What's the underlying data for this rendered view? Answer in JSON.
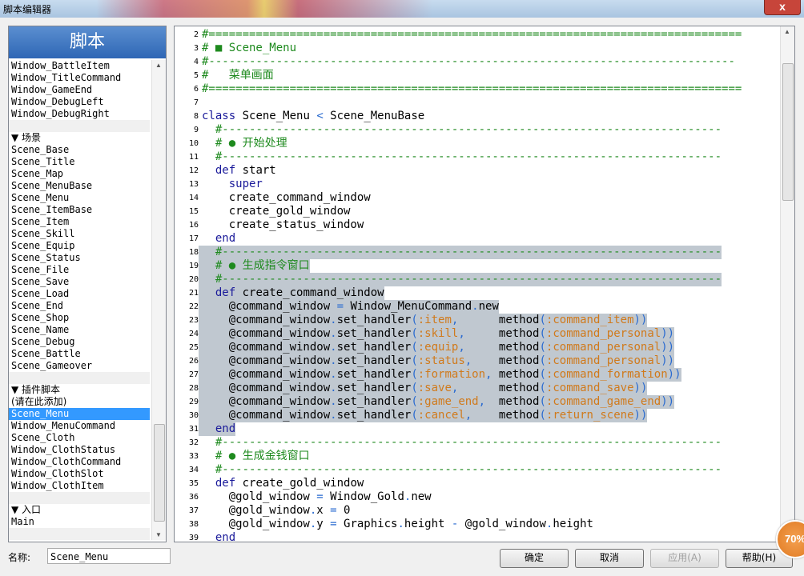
{
  "window": {
    "title": "脚本编辑器",
    "close_label": "x"
  },
  "left": {
    "header": "脚本",
    "items": [
      {
        "label": "Window_BattleItem",
        "kind": "item"
      },
      {
        "label": "Window_TitleCommand",
        "kind": "item"
      },
      {
        "label": "Window_GameEnd",
        "kind": "item"
      },
      {
        "label": "Window_DebugLeft",
        "kind": "item"
      },
      {
        "label": "Window_DebugRight",
        "kind": "item"
      },
      {
        "label": "",
        "kind": "blank"
      },
      {
        "label": "▼ 场景",
        "kind": "sec"
      },
      {
        "label": "Scene_Base",
        "kind": "item"
      },
      {
        "label": "Scene_Title",
        "kind": "item"
      },
      {
        "label": "Scene_Map",
        "kind": "item"
      },
      {
        "label": "Scene_MenuBase",
        "kind": "item"
      },
      {
        "label": "Scene_Menu",
        "kind": "item"
      },
      {
        "label": "Scene_ItemBase",
        "kind": "item"
      },
      {
        "label": "Scene_Item",
        "kind": "item"
      },
      {
        "label": "Scene_Skill",
        "kind": "item"
      },
      {
        "label": "Scene_Equip",
        "kind": "item"
      },
      {
        "label": "Scene_Status",
        "kind": "item"
      },
      {
        "label": "Scene_File",
        "kind": "item"
      },
      {
        "label": "Scene_Save",
        "kind": "item"
      },
      {
        "label": "Scene_Load",
        "kind": "item"
      },
      {
        "label": "Scene_End",
        "kind": "item"
      },
      {
        "label": "Scene_Shop",
        "kind": "item"
      },
      {
        "label": "Scene_Name",
        "kind": "item"
      },
      {
        "label": "Scene_Debug",
        "kind": "item"
      },
      {
        "label": "Scene_Battle",
        "kind": "item"
      },
      {
        "label": "Scene_Gameover",
        "kind": "item"
      },
      {
        "label": "",
        "kind": "blank"
      },
      {
        "label": "▼ 插件脚本",
        "kind": "sec"
      },
      {
        "label": "(请在此添加)",
        "kind": "sec"
      },
      {
        "label": "Scene_Menu",
        "kind": "sel"
      },
      {
        "label": "Window_MenuCommand",
        "kind": "item"
      },
      {
        "label": "Scene_Cloth",
        "kind": "item"
      },
      {
        "label": "Window_ClothStatus",
        "kind": "item"
      },
      {
        "label": "Window_ClothCommand",
        "kind": "item"
      },
      {
        "label": "Window_ClothSlot",
        "kind": "item"
      },
      {
        "label": "Window_ClothItem",
        "kind": "item"
      },
      {
        "label": "",
        "kind": "blank"
      },
      {
        "label": "▼ 入口",
        "kind": "sec"
      },
      {
        "label": "Main",
        "kind": "item"
      },
      {
        "label": "",
        "kind": "blank"
      }
    ]
  },
  "editor": {
    "lines": [
      {
        "n": "2",
        "hl": false,
        "t": [
          [
            "cm",
            "#==============================================================================="
          ]
        ]
      },
      {
        "n": "3",
        "hl": false,
        "t": [
          [
            "cm",
            "# ■ Scene_Menu"
          ]
        ]
      },
      {
        "n": "4",
        "hl": false,
        "t": [
          [
            "cm",
            "#------------------------------------------------------------------------------"
          ]
        ]
      },
      {
        "n": "5",
        "hl": false,
        "t": [
          [
            "cm",
            "#   菜单画面"
          ]
        ]
      },
      {
        "n": "6",
        "hl": false,
        "t": [
          [
            "cm",
            "#==============================================================================="
          ]
        ]
      },
      {
        "n": "7",
        "hl": false,
        "t": [
          [
            "id",
            ""
          ]
        ]
      },
      {
        "n": "8",
        "hl": false,
        "t": [
          [
            "kw",
            "class"
          ],
          [
            "id",
            " Scene_Menu "
          ],
          [
            "op",
            "<"
          ],
          [
            "id",
            " Scene_MenuBase"
          ]
        ]
      },
      {
        "n": "9",
        "hl": false,
        "t": [
          [
            "cm",
            "  #--------------------------------------------------------------------------"
          ]
        ]
      },
      {
        "n": "10",
        "hl": false,
        "t": [
          [
            "cm",
            "  # ● 开始处理"
          ]
        ]
      },
      {
        "n": "11",
        "hl": false,
        "t": [
          [
            "cm",
            "  #--------------------------------------------------------------------------"
          ]
        ]
      },
      {
        "n": "12",
        "hl": false,
        "t": [
          [
            "kw",
            "  def"
          ],
          [
            "id",
            " start"
          ]
        ]
      },
      {
        "n": "13",
        "hl": false,
        "t": [
          [
            "kw",
            "    super"
          ]
        ]
      },
      {
        "n": "14",
        "hl": false,
        "t": [
          [
            "id",
            "    create_command_window"
          ]
        ]
      },
      {
        "n": "15",
        "hl": false,
        "t": [
          [
            "id",
            "    create_gold_window"
          ]
        ]
      },
      {
        "n": "16",
        "hl": false,
        "t": [
          [
            "id",
            "    create_status_window"
          ]
        ]
      },
      {
        "n": "17",
        "hl": false,
        "t": [
          [
            "kw",
            "  end"
          ]
        ]
      },
      {
        "n": "18",
        "hl": true,
        "t": [
          [
            "cm",
            "  #--------------------------------------------------------------------------"
          ]
        ]
      },
      {
        "n": "19",
        "hl": true,
        "t": [
          [
            "cm",
            "  # ● 生成指令窗口"
          ]
        ]
      },
      {
        "n": "20",
        "hl": true,
        "t": [
          [
            "cm",
            "  #--------------------------------------------------------------------------"
          ]
        ]
      },
      {
        "n": "21",
        "hl": true,
        "t": [
          [
            "kw",
            "  def"
          ],
          [
            "id",
            " create_command_window"
          ]
        ]
      },
      {
        "n": "22",
        "hl": true,
        "t": [
          [
            "id",
            "    @command_window "
          ],
          [
            "op",
            "="
          ],
          [
            "id",
            " Window_MenuCommand"
          ],
          [
            "op",
            "."
          ],
          [
            "id",
            "new"
          ]
        ]
      },
      {
        "n": "23",
        "hl": true,
        "t": [
          [
            "id",
            "    @command_window"
          ],
          [
            "op",
            "."
          ],
          [
            "id",
            "set_handler"
          ],
          [
            "op",
            "("
          ],
          [
            "sym",
            ":item"
          ],
          [
            "op",
            ","
          ],
          [
            "id",
            "      method"
          ],
          [
            "op",
            "("
          ],
          [
            "sym",
            ":command_item"
          ],
          [
            "op",
            "))"
          ]
        ]
      },
      {
        "n": "24",
        "hl": true,
        "t": [
          [
            "id",
            "    @command_window"
          ],
          [
            "op",
            "."
          ],
          [
            "id",
            "set_handler"
          ],
          [
            "op",
            "("
          ],
          [
            "sym",
            ":skill"
          ],
          [
            "op",
            ","
          ],
          [
            "id",
            "     method"
          ],
          [
            "op",
            "("
          ],
          [
            "sym",
            ":command_personal"
          ],
          [
            "op",
            "))"
          ]
        ]
      },
      {
        "n": "25",
        "hl": true,
        "t": [
          [
            "id",
            "    @command_window"
          ],
          [
            "op",
            "."
          ],
          [
            "id",
            "set_handler"
          ],
          [
            "op",
            "("
          ],
          [
            "sym",
            ":equip"
          ],
          [
            "op",
            ","
          ],
          [
            "id",
            "     method"
          ],
          [
            "op",
            "("
          ],
          [
            "sym",
            ":command_personal"
          ],
          [
            "op",
            "))"
          ]
        ]
      },
      {
        "n": "26",
        "hl": true,
        "t": [
          [
            "id",
            "    @command_window"
          ],
          [
            "op",
            "."
          ],
          [
            "id",
            "set_handler"
          ],
          [
            "op",
            "("
          ],
          [
            "sym",
            ":status"
          ],
          [
            "op",
            ","
          ],
          [
            "id",
            "    method"
          ],
          [
            "op",
            "("
          ],
          [
            "sym",
            ":command_personal"
          ],
          [
            "op",
            "))"
          ]
        ]
      },
      {
        "n": "27",
        "hl": true,
        "t": [
          [
            "id",
            "    @command_window"
          ],
          [
            "op",
            "."
          ],
          [
            "id",
            "set_handler"
          ],
          [
            "op",
            "("
          ],
          [
            "sym",
            ":formation"
          ],
          [
            "op",
            ","
          ],
          [
            "id",
            " method"
          ],
          [
            "op",
            "("
          ],
          [
            "sym",
            ":command_formation"
          ],
          [
            "op",
            "))"
          ]
        ]
      },
      {
        "n": "28",
        "hl": true,
        "t": [
          [
            "id",
            "    @command_window"
          ],
          [
            "op",
            "."
          ],
          [
            "id",
            "set_handler"
          ],
          [
            "op",
            "("
          ],
          [
            "sym",
            ":save"
          ],
          [
            "op",
            ","
          ],
          [
            "id",
            "      method"
          ],
          [
            "op",
            "("
          ],
          [
            "sym",
            ":command_save"
          ],
          [
            "op",
            "))"
          ]
        ]
      },
      {
        "n": "29",
        "hl": true,
        "t": [
          [
            "id",
            "    @command_window"
          ],
          [
            "op",
            "."
          ],
          [
            "id",
            "set_handler"
          ],
          [
            "op",
            "("
          ],
          [
            "sym",
            ":game_end"
          ],
          [
            "op",
            ","
          ],
          [
            "id",
            "  method"
          ],
          [
            "op",
            "("
          ],
          [
            "sym",
            ":command_game_end"
          ],
          [
            "op",
            "))"
          ]
        ]
      },
      {
        "n": "30",
        "hl": true,
        "t": [
          [
            "id",
            "    @command_window"
          ],
          [
            "op",
            "."
          ],
          [
            "id",
            "set_handler"
          ],
          [
            "op",
            "("
          ],
          [
            "sym",
            ":cancel"
          ],
          [
            "op",
            ","
          ],
          [
            "id",
            "    method"
          ],
          [
            "op",
            "("
          ],
          [
            "sym",
            ":return_scene"
          ],
          [
            "op",
            "))"
          ]
        ]
      },
      {
        "n": "31",
        "hl": true,
        "t": [
          [
            "kw",
            "  end"
          ]
        ]
      },
      {
        "n": "32",
        "hl": false,
        "t": [
          [
            "cm",
            "  #--------------------------------------------------------------------------"
          ]
        ]
      },
      {
        "n": "33",
        "hl": false,
        "t": [
          [
            "cm",
            "  # ● 生成金钱窗口"
          ]
        ]
      },
      {
        "n": "34",
        "hl": false,
        "t": [
          [
            "cm",
            "  #--------------------------------------------------------------------------"
          ]
        ]
      },
      {
        "n": "35",
        "hl": false,
        "t": [
          [
            "kw",
            "  def"
          ],
          [
            "id",
            " create_gold_window"
          ]
        ]
      },
      {
        "n": "36",
        "hl": false,
        "t": [
          [
            "id",
            "    @gold_window "
          ],
          [
            "op",
            "="
          ],
          [
            "id",
            " Window_Gold"
          ],
          [
            "op",
            "."
          ],
          [
            "id",
            "new"
          ]
        ]
      },
      {
        "n": "37",
        "hl": false,
        "t": [
          [
            "id",
            "    @gold_window"
          ],
          [
            "op",
            "."
          ],
          [
            "id",
            "x "
          ],
          [
            "op",
            "="
          ],
          [
            "id",
            " 0"
          ]
        ]
      },
      {
        "n": "38",
        "hl": false,
        "t": [
          [
            "id",
            "    @gold_window"
          ],
          [
            "op",
            "."
          ],
          [
            "id",
            "y "
          ],
          [
            "op",
            "="
          ],
          [
            "id",
            " Graphics"
          ],
          [
            "op",
            "."
          ],
          [
            "id",
            "height "
          ],
          [
            "op",
            "-"
          ],
          [
            "id",
            " @gold_window"
          ],
          [
            "op",
            "."
          ],
          [
            "id",
            "height"
          ]
        ]
      },
      {
        "n": "39",
        "hl": false,
        "t": [
          [
            "kw",
            "  end"
          ]
        ]
      }
    ]
  },
  "bottom": {
    "name_label": "名称:",
    "name_value": "Scene_Menu",
    "ok_label": "确定",
    "cancel_label": "取消",
    "apply_label": "应用(A)",
    "help_label": "帮助(H)"
  },
  "zoom_badge": "70%",
  "colors": {
    "comment": "#1e8a1e",
    "keyword": "#1a1a9a",
    "symbol": "#d07a1c",
    "operator": "#2a6bd0",
    "selection": "#3399ff",
    "line_highlight": "#c0c8d0"
  }
}
